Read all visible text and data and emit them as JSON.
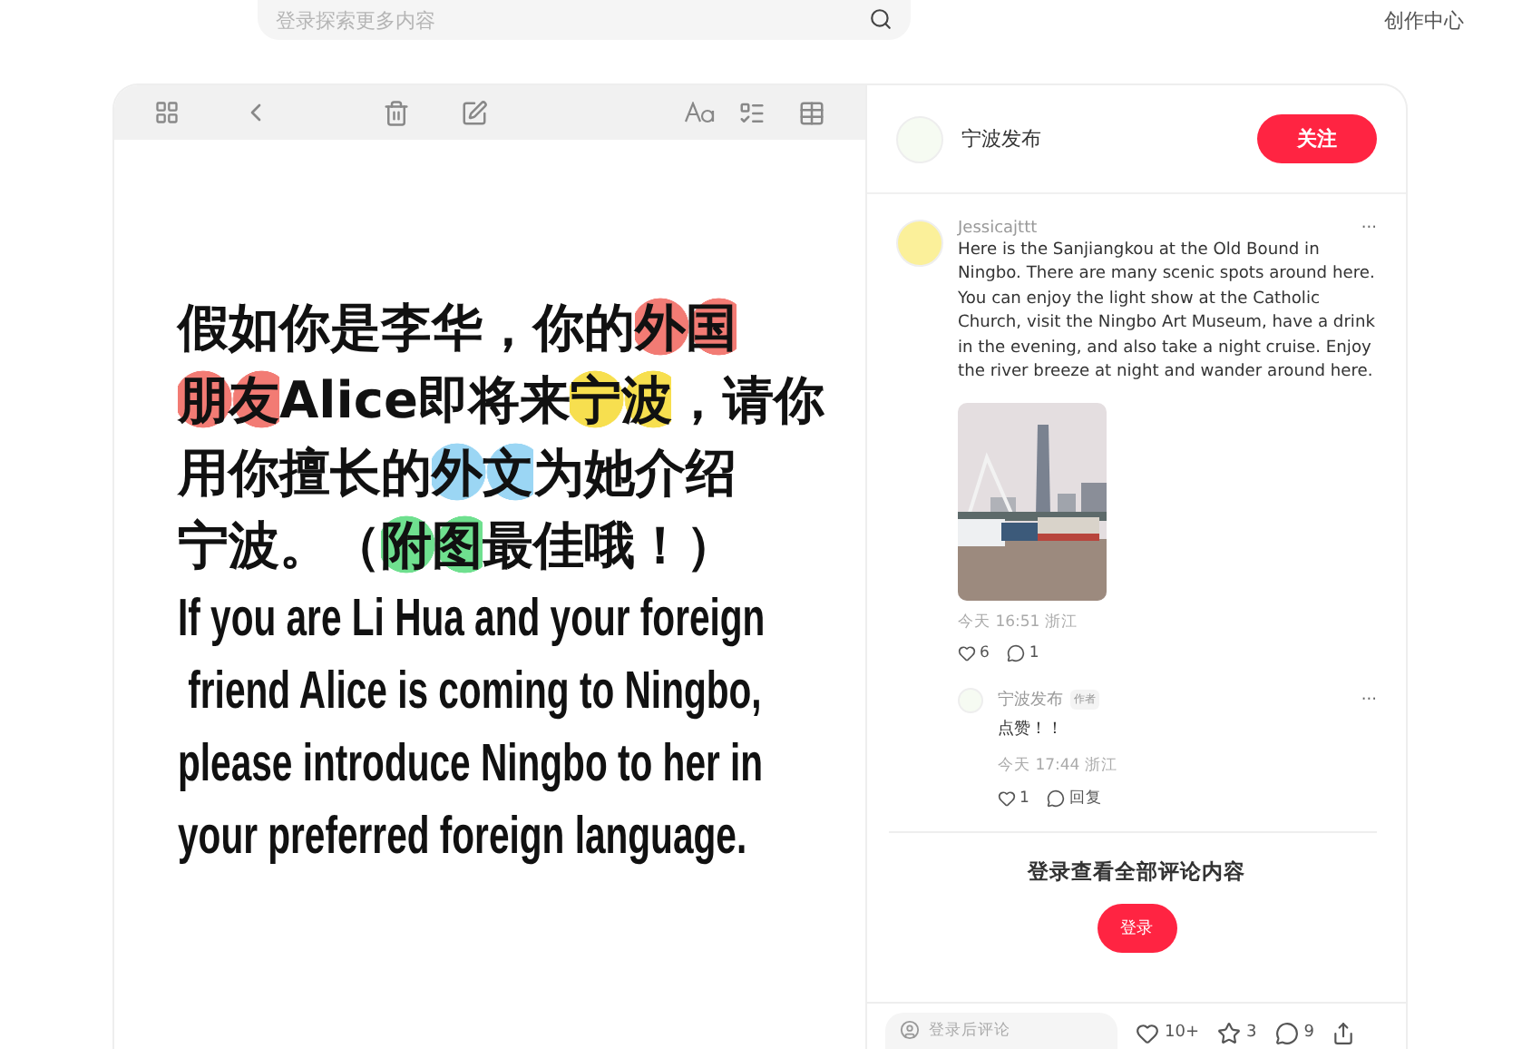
{
  "top_bar": {
    "search": {
      "placeholder": "登录探索更多内容"
    },
    "links": [
      "创作中心"
    ]
  },
  "note": {
    "cn_lines": [
      [
        {
          "text": "假如你是李华，你的"
        },
        {
          "text": "外国",
          "color": "#f27b74"
        }
      ],
      [
        {
          "text": "朋友",
          "color": "#f27b74"
        },
        {
          "text": "Alice即将来"
        },
        {
          "text": "宁波",
          "color": "#f7df4f"
        },
        {
          "text": "，请你"
        }
      ],
      [
        {
          "text": "用你擅长的"
        },
        {
          "text": "外文",
          "color": "#9bd6f4"
        },
        {
          "text": "为她介绍"
        }
      ],
      [
        {
          "text": "宁波。（"
        },
        {
          "text": "附图",
          "color": "#6fe08f"
        },
        {
          "text": "最佳哦！）"
        }
      ]
    ],
    "en_lines": [
      "If you are Li Hua and your foreign",
      " friend Alice is coming to Ningbo,",
      "please introduce Ningbo to her in",
      "your preferred foreign language."
    ]
  },
  "author": {
    "name": "宁波发布",
    "follow_button": "关注"
  },
  "comments": [
    {
      "user": "Jessicajttt",
      "more": "···",
      "text": "Here is the Sanjiangkou at the Old Bound in Ningbo. There are many scenic spots around here. You can enjoy the light show at the Catholic Church, visit the Ningbo Art Museum, have a drink in the evening, and also take a night cruise. Enjoy the river breeze at night and wander around here.",
      "image": {
        "kind": "picture"
      },
      "time": "今天 16:51 浙江",
      "likes": "6",
      "replies_count": "1",
      "replies": [
        {
          "user": "宁波发布",
          "badge": "作者",
          "more": "···",
          "text": "点赞！！",
          "time": "今天 17:44 浙江",
          "likes": "1",
          "reply_label": "回复"
        }
      ]
    }
  ],
  "login_prompt": {
    "text": "登录查看全部评论内容",
    "button": "登录"
  },
  "bottom_bar": {
    "comment_field": {
      "placeholder": "登录后评论"
    },
    "likes": "10+",
    "stars": "3",
    "comments": "9"
  }
}
